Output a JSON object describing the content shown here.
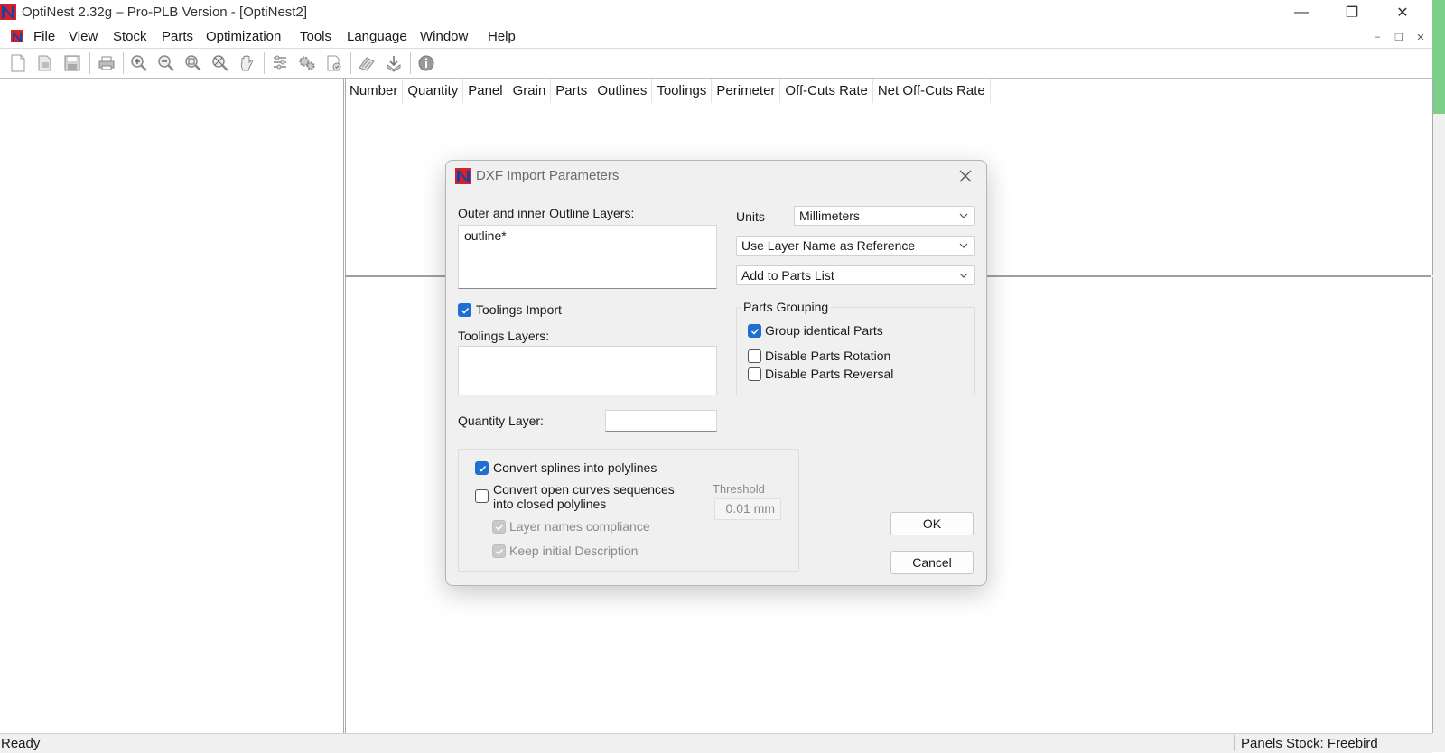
{
  "window": {
    "title": "OptiNest 2.32g – Pro-PLB Version - [OptiNest2]",
    "minimize": "—",
    "maximize": "❐",
    "close": "✕"
  },
  "menu": {
    "items": [
      "File",
      "View",
      "Stock",
      "Parts",
      "Optimization",
      "Tools",
      "Language",
      "Window",
      "Help"
    ],
    "mdi_minimize": "–",
    "mdi_restore": "❐",
    "mdi_close": "✕"
  },
  "table": {
    "columns": [
      "Number",
      "Quantity",
      "Panel",
      "Grain",
      "Parts",
      "Outlines",
      "Toolings",
      "Perimeter",
      "Off-Cuts Rate",
      "Net Off-Cuts Rate"
    ]
  },
  "status": {
    "left": "Ready",
    "right": "Panels Stock: Freebird"
  },
  "dialog": {
    "title": "DXF Import Parameters",
    "outline_layers_label": "Outer and inner Outline Layers:",
    "outline_layers_value": "outline*",
    "toolings_import_label": "Toolings Import",
    "toolings_import_checked": true,
    "toolings_layers_label": "Toolings Layers:",
    "toolings_layers_value": "",
    "quantity_layer_label": "Quantity Layer:",
    "quantity_layer_value": "",
    "units_label": "Units",
    "units_value": "Millimeters",
    "reference_value": "Use Layer Name as Reference",
    "destination_value": "Add to Parts List",
    "parts_grouping_label": "Parts Grouping",
    "group_identical_label": "Group identical Parts",
    "group_identical_checked": true,
    "disable_rotation_label": "Disable Parts Rotation",
    "disable_rotation_checked": false,
    "disable_reversal_label": "Disable Parts Reversal",
    "disable_reversal_checked": false,
    "convert_splines_label": "Convert splines into polylines",
    "convert_splines_checked": true,
    "convert_open_label_1": "Convert open curves sequences",
    "convert_open_label_2": "into closed polylines",
    "convert_open_checked": false,
    "threshold_label": "Threshold",
    "threshold_value": "0.01 mm",
    "layer_names_label": "Layer names compliance",
    "keep_desc_label": "Keep initial Description",
    "ok_label": "OK",
    "cancel_label": "Cancel"
  },
  "colors": {
    "accent": "#1e6fd1",
    "app_icon_red": "#d2232a",
    "app_icon_blue": "#1a3fa8",
    "side_green": "#7ccf88"
  },
  "icons": {
    "toolbar": [
      "new-icon",
      "open-icon",
      "save-icon",
      "print-icon",
      "zoom-in-icon",
      "zoom-out-icon",
      "zoom-fit-icon",
      "zoom-all-icon",
      "pan-hand-icon",
      "settings-list-icon",
      "gears-icon",
      "report-icon",
      "nest-icon",
      "export-icon",
      "info-icon"
    ]
  }
}
